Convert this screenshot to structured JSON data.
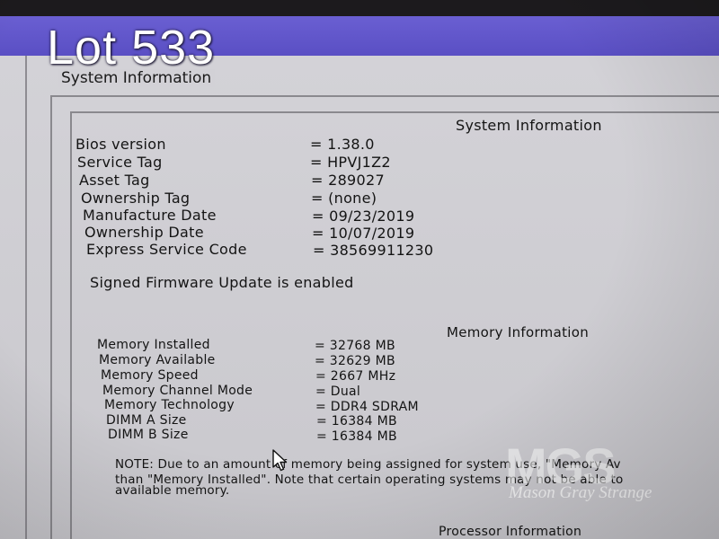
{
  "overlay": {
    "lot_label": "Lot 533",
    "watermark_logo": "MGS",
    "watermark_name": "Mason Gray Strange"
  },
  "panel": {
    "legend": "System Information"
  },
  "system_info": {
    "heading": "System Information",
    "rows": [
      {
        "label": "Bios version",
        "value": "= 1.38.0"
      },
      {
        "label": "Service Tag",
        "value": "= HPVJ1Z2"
      },
      {
        "label": "Asset Tag",
        "value": "= 289027"
      },
      {
        "label": "Ownership Tag",
        "value": "= (none)"
      },
      {
        "label": "Manufacture Date",
        "value": "= 09/23/2019"
      },
      {
        "label": "Ownership Date",
        "value": "= 10/07/2019"
      },
      {
        "label": "Express Service Code",
        "value": "= 38569911230"
      }
    ],
    "firmware_status": "Signed Firmware Update is enabled"
  },
  "memory_info": {
    "heading": "Memory Information",
    "rows": [
      {
        "label": "Memory Installed",
        "value": "= 32768 MB"
      },
      {
        "label": "Memory Available",
        "value": "= 32629 MB"
      },
      {
        "label": "Memory Speed",
        "value": "= 2667 MHz"
      },
      {
        "label": "Memory Channel Mode",
        "value": "= Dual"
      },
      {
        "label": "Memory Technology",
        "value": "= DDR4 SDRAM"
      },
      {
        "label": "DIMM A Size",
        "value": "= 16384 MB"
      },
      {
        "label": "DIMM B Size",
        "value": "= 16384 MB"
      }
    ],
    "note_lines": [
      "NOTE: Due to an amount of memory being assigned for system use, \"Memory Av",
      "than \"Memory Installed\". Note that certain operating systems may not be able to",
      "available memory."
    ]
  },
  "processor_info": {
    "heading": "Processor Information"
  },
  "icons": {
    "cursor": "mouse-pointer-icon"
  }
}
